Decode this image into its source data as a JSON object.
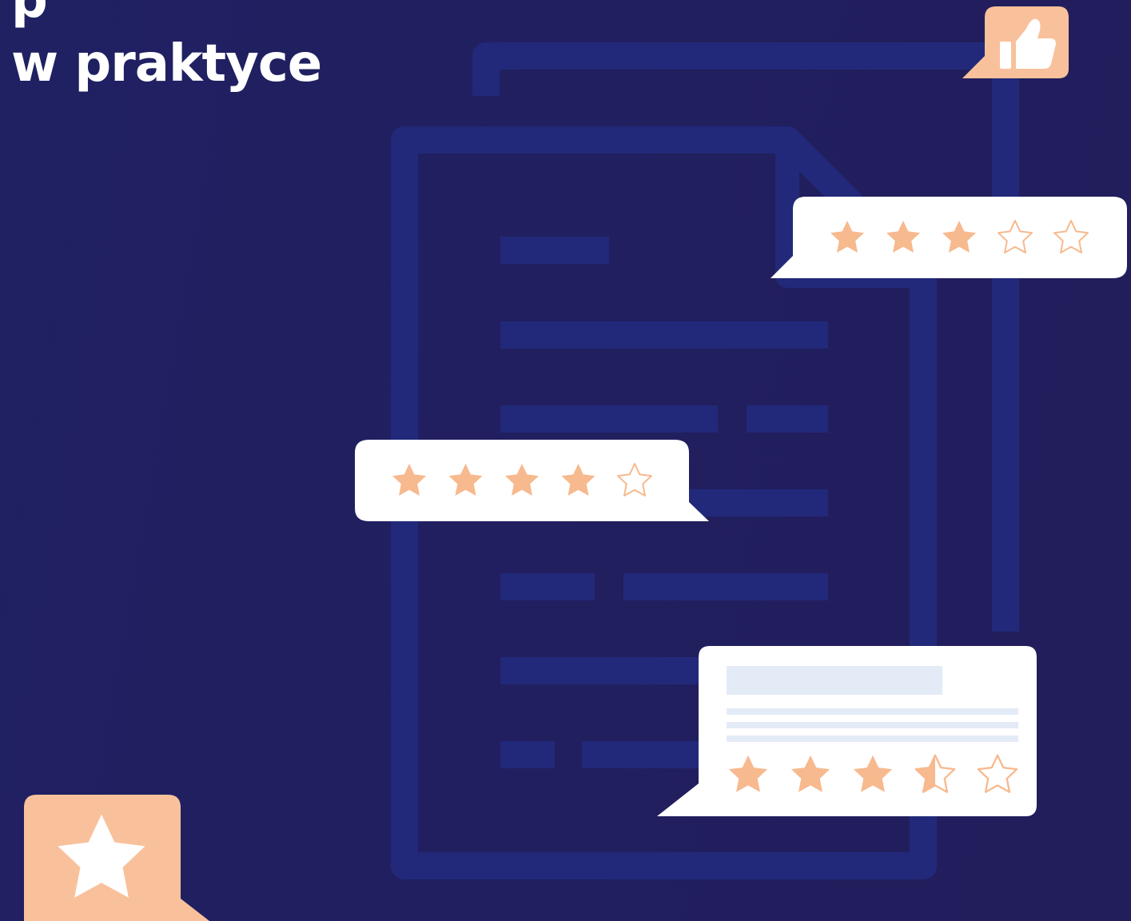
{
  "headline": {
    "line1": "p",
    "line2": "w praktyce"
  },
  "colors": {
    "background": "#211f5f",
    "document_outline": "#22297a",
    "bubble_white": "#ffffff",
    "accent_peach": "#f9c19b",
    "star_filled": "#f7b98e",
    "placeholder_line": "#e3ebf7"
  },
  "icons": {
    "thumbs_up_badge": "thumbs-up-icon",
    "star_badge": "star-icon",
    "document": "document-icon"
  },
  "ratings": [
    {
      "name": "rating-bubble-top",
      "filled": 3,
      "total": 5
    },
    {
      "name": "rating-bubble-middle",
      "filled": 4,
      "total": 5
    },
    {
      "name": "rating-bubble-bottom",
      "filled": 3.5,
      "total": 5
    }
  ]
}
